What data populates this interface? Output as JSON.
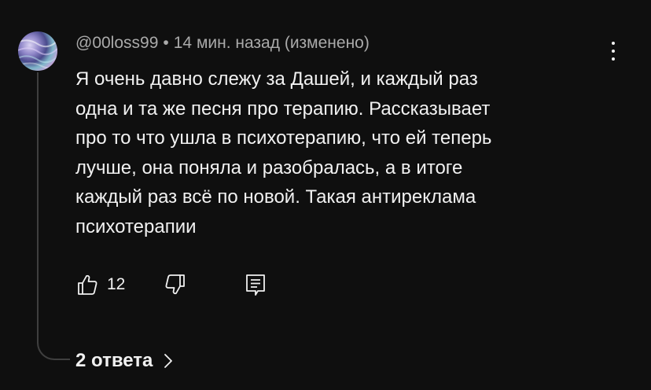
{
  "comment": {
    "author": "@00loss99",
    "separator": "•",
    "time": "14 мин. назад",
    "edited": "(изменено)",
    "text_lines": [
      "Я очень давно слежу за Дашей, и каждый раз",
      "одна и та же песня про терапию. Рассказывает",
      "про то что ушла в психотерапию, что ей теперь",
      "лучше, она поняла и разобралась, а в итоге",
      "каждый раз всё по новой. Такая антиреклама",
      "психотерапии"
    ],
    "likes": "12",
    "replies_label": "2 ответа"
  },
  "icons": {
    "avatar": "avatar-image",
    "more": "more-vertical-icon",
    "like": "thumb-up-icon",
    "dislike": "thumb-down-icon",
    "reply": "reply-comment-icon",
    "expand": "chevron-right-icon"
  },
  "colors": {
    "background": "#0f0f0f",
    "text": "#f1f1f1",
    "secondary_text": "#aaaaaa",
    "thread_line": "#3f3f3f"
  }
}
